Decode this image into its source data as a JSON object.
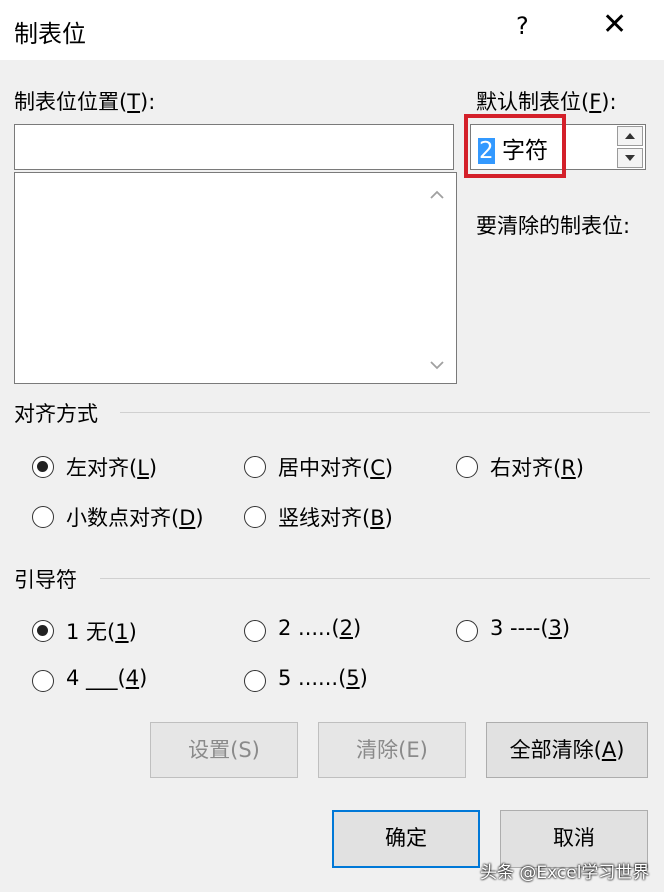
{
  "window": {
    "title": "制表位",
    "help_glyph": "?",
    "close_glyph": "✕"
  },
  "tab_position": {
    "label_text": "制表位位置(",
    "label_key": "T",
    "label_end": "):",
    "value": ""
  },
  "default_tab": {
    "label_text": "默认制表位(",
    "label_key": "F",
    "label_end": "):",
    "value_number": "2",
    "value_unit": " 字符"
  },
  "tabs_to_clear": {
    "label": "要清除的制表位:"
  },
  "alignment": {
    "title": "对齐方式",
    "options": [
      {
        "text": "左对齐(",
        "key": "L",
        "end": ")",
        "checked": true
      },
      {
        "text": "居中对齐(",
        "key": "C",
        "end": ")",
        "checked": false
      },
      {
        "text": "右对齐(",
        "key": "R",
        "end": ")",
        "checked": false
      },
      {
        "text": "小数点对齐(",
        "key": "D",
        "end": ")",
        "checked": false
      },
      {
        "text": "竖线对齐(",
        "key": "B",
        "end": ")",
        "checked": false
      }
    ]
  },
  "leader": {
    "title": "引导符",
    "options": [
      {
        "text": "1 无(",
        "key": "1",
        "end": ")",
        "checked": true
      },
      {
        "text": "2 .....(",
        "key": "2",
        "end": ")",
        "checked": false
      },
      {
        "text": "3 ----(",
        "key": "3",
        "end": ")",
        "checked": false
      },
      {
        "text": "4 ___(",
        "key": "4",
        "end": ")",
        "checked": false
      },
      {
        "text": "5 ......(",
        "key": "5",
        "end": ")",
        "checked": false
      }
    ]
  },
  "buttons": {
    "set": "设置(S)",
    "clear": "清除(E)",
    "clear_all_text": "全部清除(",
    "clear_all_key": "A",
    "clear_all_end": ")",
    "ok": "确定",
    "cancel": "取消"
  },
  "watermark": "头条 @Excel学习世界"
}
